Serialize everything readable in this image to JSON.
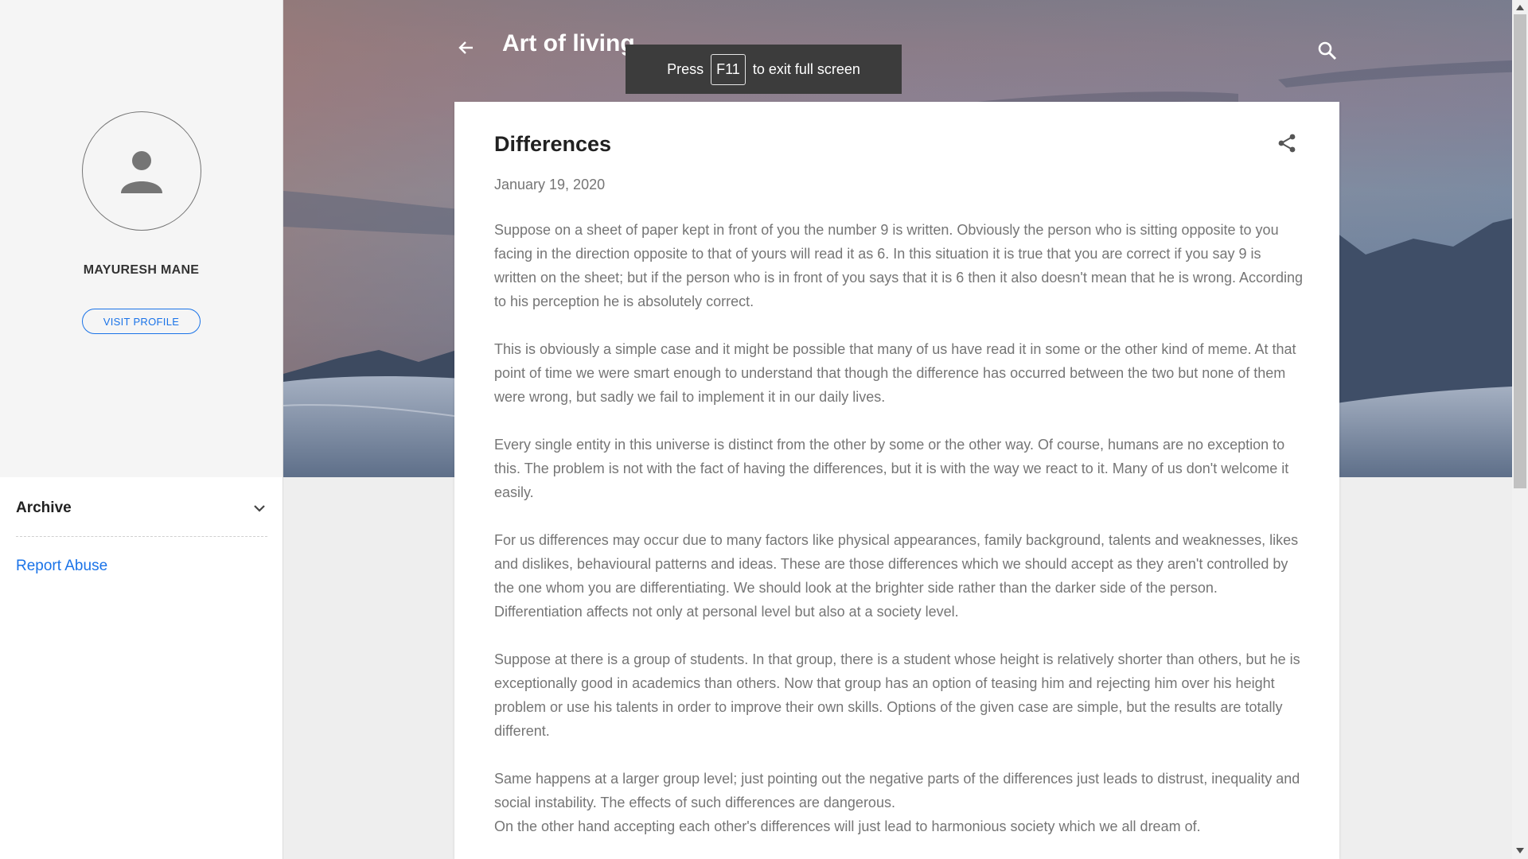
{
  "sidebar": {
    "profile_name": "MAYURESH MANE",
    "visit_profile_label": "VISIT PROFILE",
    "archive_label": "Archive",
    "report_abuse_label": "Report Abuse"
  },
  "header": {
    "blog_title": "Art of living"
  },
  "fullscreen_toast": {
    "prefix": "Press",
    "key": "F11",
    "suffix": "to exit full screen"
  },
  "post": {
    "title": "Differences",
    "date": "January 19, 2020",
    "paragraphs": [
      "Suppose on a sheet of paper kept in front of you the number 9 is written. Obviously the person who is sitting opposite to you facing in the direction opposite to that of yours will read it as 6. In this situation it is true that you are correct if you say 9 is written on the sheet; but if the person who is in front of you says that it is 6 then it also doesn't mean that he is wrong. According to his perception he is absolutely correct.",
      "This is obviously a simple case and it might be possible that many of us have read it in some or the other kind of meme. At that point of time we were smart enough to understand that though the difference has occurred between the two but none of them were wrong, but sadly we fail to implement it in our daily lives.",
      "Every single entity in this universe is distinct from the other by some or the other way. Of course, humans are no exception to this. The problem is not with the fact of having the differences, but it is with the way we react to it. Many of us don't welcome it easily.",
      "For us differences may occur due to many factors like physical appearances, family background, talents and weaknesses, likes and dislikes, behavioural patterns and ideas. These are those differences which we should accept as they aren't controlled by the one whom you are differentiating. We should look at the brighter side rather than the darker side of the person. Differentiation affects not only at personal level but also at a society level.",
      "Suppose at there is a group of students. In that group, there is a student whose height is relatively shorter than others, but he is exceptionally good in academics than others. Now that group has an option of teasing him and rejecting him over his height problem or use his talents in order to improve their own skills. Options of the given case are simple, but the results are totally different.",
      "Same happens at a larger group level; just pointing out the negative parts of the differences just leads to distrust, inequality and social instability. The effects of such differences are dangerous."
    ],
    "last_line": "On the other hand accepting each other's differences will just lead to harmonious society which we all dream of."
  },
  "icons": {
    "avatar": "person-icon",
    "back": "arrow-left-icon",
    "search": "search-icon",
    "share": "share-icon",
    "archive_toggle": "chevron-down-icon"
  },
  "colors": {
    "accent": "#1a73e8",
    "body_text": "#757575",
    "title_text": "#212121",
    "sidebar_bg": "#f5f5f5",
    "page_bg": "#eeeeee"
  }
}
